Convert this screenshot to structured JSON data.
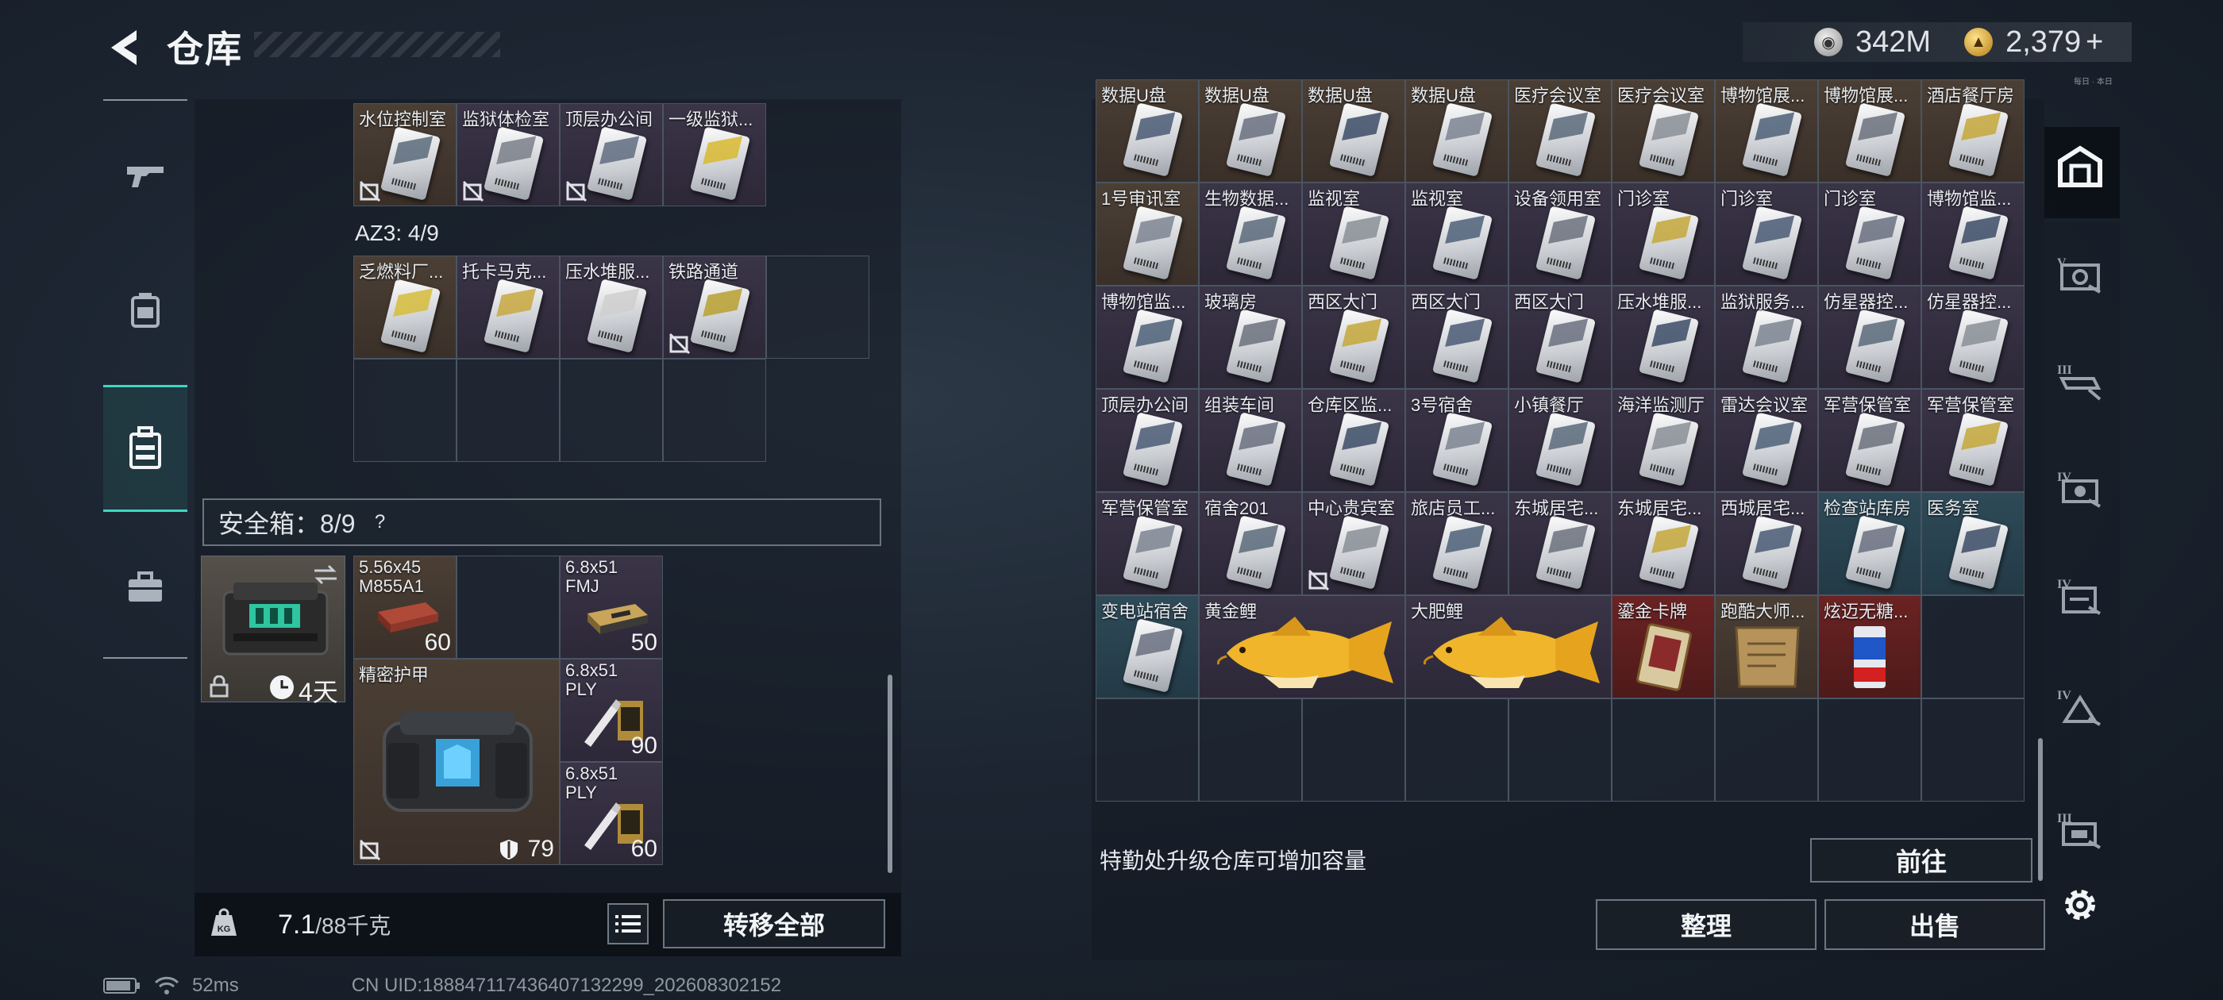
{
  "header": {
    "title": "仓库",
    "silver_amount": "342M",
    "gold_amount": "2,379",
    "gold_plus": "+",
    "tiny_note": "每日 · 本日"
  },
  "left": {
    "top_row": [
      {
        "label": "水位控制室",
        "nolock": true
      },
      {
        "label": "监狱体检室",
        "nolock": true
      },
      {
        "label": "顶层办公间",
        "nolock": true
      },
      {
        "label": "一级监狱...",
        "nolock": false
      }
    ],
    "az3_label": "AZ3: 4/9",
    "az3_items": [
      {
        "label": "乏燃料厂...",
        "nolock": false
      },
      {
        "label": "托卡马克...",
        "nolock": false
      },
      {
        "label": "压水堆服...",
        "nolock": false
      },
      {
        "label": "铁路通道",
        "nolock": true
      }
    ],
    "safe_label": "安全箱：8/9",
    "safe_help": "?",
    "safe_days": "4天",
    "ammo": [
      {
        "name": "5.56x45\nM855A1",
        "count": "60"
      },
      {
        "name": "6.8x51\nFMJ",
        "count": "50"
      },
      {
        "name": "6.8x51\nPLY",
        "count": "90"
      },
      {
        "name": "6.8x51\nPLY",
        "count": "60"
      }
    ],
    "armor_label": "精密护甲",
    "armor_durability": "79",
    "weight_value": "7.1",
    "weight_max": "/88千克",
    "weight_icon_text": "KG",
    "transfer_all": "转移全部"
  },
  "right": {
    "rows": [
      [
        "数据U盘",
        "数据U盘",
        "数据U盘",
        "数据U盘",
        "医疗会议室",
        "医疗会议室",
        "博物馆展...",
        "博物馆展...",
        "酒店餐厅房"
      ],
      [
        "1号审讯室",
        "生物数据...",
        "监视室",
        "监视室",
        "设备领用室",
        "门诊室",
        "门诊室",
        "门诊室",
        "博物馆监..."
      ],
      [
        "博物馆监...",
        "玻璃房",
        "西区大门",
        "西区大门",
        "西区大门",
        "压水堆服...",
        "监狱服务...",
        "仿星器控...",
        "仿星器控..."
      ],
      [
        "顶层办公间",
        "组装车间",
        "仓库区监...",
        "3号宿舍",
        "小镇餐厅",
        "海洋监测厅",
        "雷达会议室",
        "军营保管室",
        "军营保管室"
      ],
      [
        "军营保管室",
        "宿舍201",
        "中心贵宾室",
        "旅店员工...",
        "东城居宅...",
        "东城居宅...",
        "西城居宅...",
        "检查站库房",
        "医务室"
      ]
    ],
    "last_row": {
      "card": "变电站宿舍",
      "fish1": "黄金鲤",
      "fish2": "大肥鲤",
      "item1": "鎏金卡牌",
      "item2": "跑酷大师...",
      "item3": "炫迈无糖..."
    },
    "upgrade_text": "特勤处升级仓库可增加容量",
    "goto_button": "前往",
    "sort_button": "整理",
    "sell_button": "出售"
  },
  "status": {
    "ping": "52ms",
    "uid": "CN UID:188847117436407132299_202608302152"
  },
  "colors": {
    "accent_teal": "#3fd6c1",
    "panel_border": "#4a5562",
    "fish_gold": "#f0b52a"
  },
  "icons": {
    "nav": [
      "gun-icon",
      "helmet-icon",
      "backpack-icon",
      "briefcase-icon"
    ],
    "rnav": [
      "warehouse-icon",
      "safe-level-v-icon",
      "safe-level-iii-icon",
      "safe-level-iv-icon",
      "safe-level-iv-b-icon",
      "safe-level-iv-c-icon",
      "safe-level-iii-b-icon",
      "settings-icon"
    ]
  }
}
